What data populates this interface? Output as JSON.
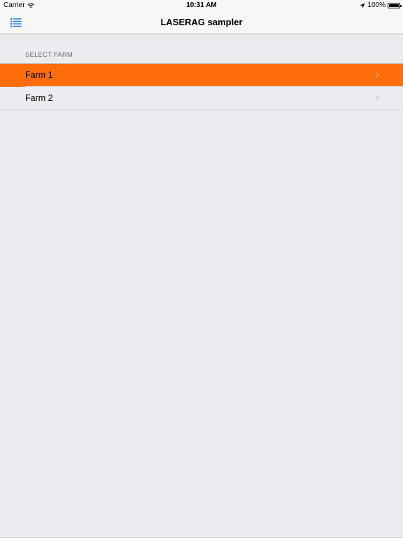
{
  "status_bar": {
    "carrier": "Carrier",
    "time": "10:31 AM",
    "battery": "100%"
  },
  "nav": {
    "title": "LASERAG sampler",
    "menu_icon": "list-icon"
  },
  "section": {
    "header": "SELECT FARM",
    "rows": [
      {
        "label": "Farm 1",
        "selected": true
      },
      {
        "label": "Farm 2",
        "selected": false
      }
    ]
  },
  "colors": {
    "accent": "#1a78d6",
    "selected_row": "#ff6d0a",
    "background": "#ebebf0"
  }
}
